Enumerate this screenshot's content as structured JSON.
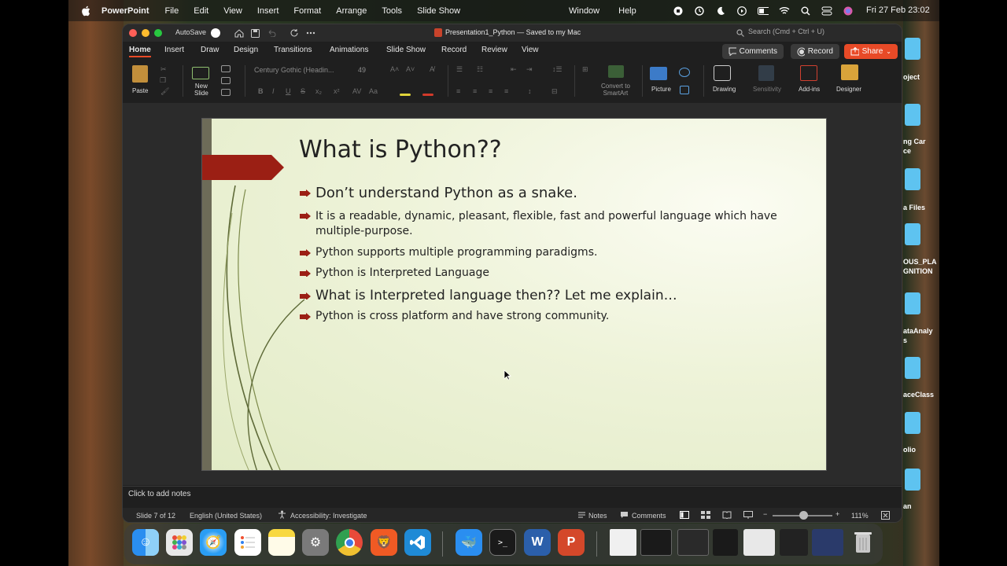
{
  "menubar": {
    "app_name": "PowerPoint",
    "menus": [
      "File",
      "Edit",
      "View",
      "Insert",
      "Format",
      "Arrange",
      "Tools",
      "Slide Show"
    ],
    "right_menus": [
      "Window",
      "Help"
    ],
    "clock": "Fri 27 Feb  23:02"
  },
  "desktop": {
    "labels": [
      "oject",
      "ng Car",
      "ce",
      "a Files",
      "OUS_PLA",
      "GNITION",
      "ataAnaly",
      "s",
      "aceClass",
      "olio",
      "an"
    ]
  },
  "window": {
    "autosave_label": "AutoSave",
    "doc_title": "Presentation1_Python  —  Saved to my Mac",
    "search_placeholder": "Search (Cmd + Ctrl + U)"
  },
  "ribbon": {
    "tabs": [
      "Home",
      "Insert",
      "Draw",
      "Design",
      "Transitions",
      "Animations",
      "Slide Show",
      "Record",
      "Review",
      "View"
    ],
    "comments_label": "Comments",
    "record_label": "Record",
    "share_label": "Share",
    "paste_label": "Paste",
    "new_slide_label": "New\nSlide",
    "font_name": "Century Gothic (Headin...",
    "font_size": "49",
    "convert_label": "Convert to\nSmartArt",
    "picture_label": "Picture",
    "drawing_label": "Drawing",
    "sensitivity_label": "Sensitivity",
    "addins_label": "Add-ins",
    "designer_label": "Designer",
    "colors": {
      "accent": "#e84a27"
    }
  },
  "slide": {
    "title": "What is Python??",
    "bullets": [
      "Don’t understand Python as a snake.",
      "It is a readable, dynamic, pleasant, flexible, fast and powerful language which have multiple-purpose.",
      "Python supports multiple programming paradigms.",
      "Python is Interpreted Language",
      "What is Interpreted language then?? Let me explain…",
      "Python is cross platform and have strong community."
    ]
  },
  "notes": {
    "placeholder": "Click to add notes"
  },
  "status": {
    "slide_counter": "Slide 7 of 12",
    "language": "English (United States)",
    "accessibility": "Accessibility: Investigate",
    "notes_label": "Notes",
    "comments_label": "Comments",
    "zoom": "111%"
  },
  "dock": {
    "apps": [
      "finder",
      "launchpad",
      "safari",
      "reminders",
      "notes",
      "system-settings",
      "chrome",
      "brave",
      "vscode",
      "docker",
      "terminal",
      "word",
      "powerpoint"
    ]
  }
}
